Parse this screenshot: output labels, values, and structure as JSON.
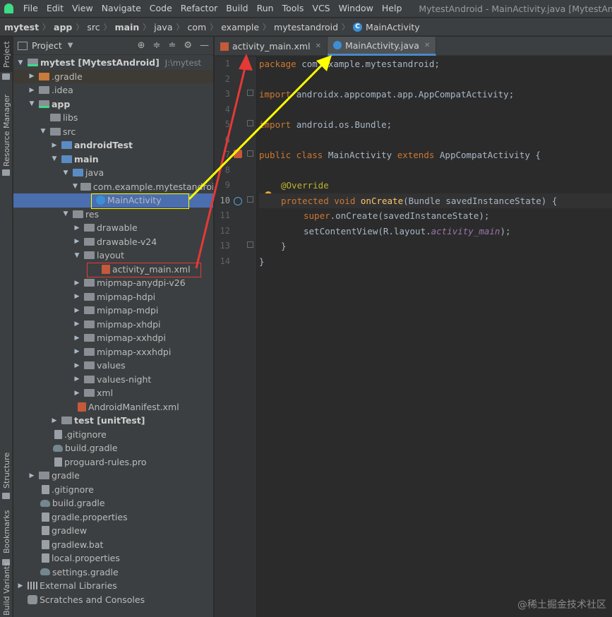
{
  "menubar": {
    "items": [
      "File",
      "Edit",
      "View",
      "Navigate",
      "Code",
      "Refactor",
      "Build",
      "Run",
      "Tools",
      "VCS",
      "Window",
      "Help"
    ],
    "window_title": "MytestAndroid - MainActivity.java [MytestAndroid.app]"
  },
  "breadcrumb": {
    "items": [
      "mytest",
      "app",
      "src",
      "main",
      "java",
      "com",
      "example",
      "mytestandroid",
      "MainActivity"
    ]
  },
  "left_strip": {
    "tabs": [
      "Project",
      "Resource Manager",
      "Structure",
      "Bookmarks",
      "Build Variants"
    ]
  },
  "project_panel": {
    "title": "Project",
    "tree": [
      {
        "label": "mytest [MytestAndroid]",
        "path": "J:\\mytest"
      },
      {
        "label": ".gradle"
      },
      {
        "label": ".idea"
      },
      {
        "label": "app"
      },
      {
        "label": "libs"
      },
      {
        "label": "src"
      },
      {
        "label": "androidTest"
      },
      {
        "label": "main"
      },
      {
        "label": "java"
      },
      {
        "label": "com.example.mytestandroid"
      },
      {
        "label": "MainActivity"
      },
      {
        "label": "res"
      },
      {
        "label": "drawable"
      },
      {
        "label": "drawable-v24"
      },
      {
        "label": "layout"
      },
      {
        "label": "activity_main.xml"
      },
      {
        "label": "mipmap-anydpi-v26"
      },
      {
        "label": "mipmap-hdpi"
      },
      {
        "label": "mipmap-mdpi"
      },
      {
        "label": "mipmap-xhdpi"
      },
      {
        "label": "mipmap-xxhdpi"
      },
      {
        "label": "mipmap-xxxhdpi"
      },
      {
        "label": "values"
      },
      {
        "label": "values-night"
      },
      {
        "label": "xml"
      },
      {
        "label": "AndroidManifest.xml"
      },
      {
        "label": "test [unitTest]"
      },
      {
        "label": ".gitignore"
      },
      {
        "label": "build.gradle"
      },
      {
        "label": "proguard-rules.pro"
      },
      {
        "label": "gradle"
      },
      {
        "label": ".gitignore"
      },
      {
        "label": "build.gradle"
      },
      {
        "label": "gradle.properties"
      },
      {
        "label": "gradlew"
      },
      {
        "label": "gradlew.bat"
      },
      {
        "label": "local.properties"
      },
      {
        "label": "settings.gradle"
      },
      {
        "label": "External Libraries"
      },
      {
        "label": "Scratches and Consoles"
      }
    ]
  },
  "editor": {
    "tabs": [
      "activity_main.xml",
      "MainActivity.java"
    ],
    "line_numbers": [
      "1",
      "2",
      "3",
      "4",
      "5",
      "6",
      "7",
      "8",
      "9",
      "10",
      "11",
      "12",
      "13",
      "14"
    ],
    "code": {
      "l1_kw": "package ",
      "l1_rest": "com.example.mytestandroid;",
      "l3_kw": "import ",
      "l3_rest": "androidx.appcompat.app.AppCompatActivity;",
      "l5_kw": "import ",
      "l5_rest": "android.os.Bundle;",
      "l7_kw1": "public class ",
      "l7_name": "MainActivity ",
      "l7_kw2": "extends ",
      "l7_rest": "AppCompatActivity {",
      "l9_ann": "@Override",
      "l10_kw": "protected void ",
      "l10_fn": "onCreate",
      "l10_rest": "(Bundle savedInstanceState) {",
      "l11_kw": "super",
      "l11_rest": ".onCreate(savedInstanceState);",
      "l12_a": "setContentView(R.layout.",
      "l12_it": "activity_main",
      "l12_b": ");",
      "l13": "}",
      "l14": "}"
    }
  },
  "watermark": "@稀土掘金技术社区",
  "colors": {
    "annotation_red": "#e53935",
    "annotation_yellow": "#ffff00",
    "selection": "#4b6eaf"
  }
}
